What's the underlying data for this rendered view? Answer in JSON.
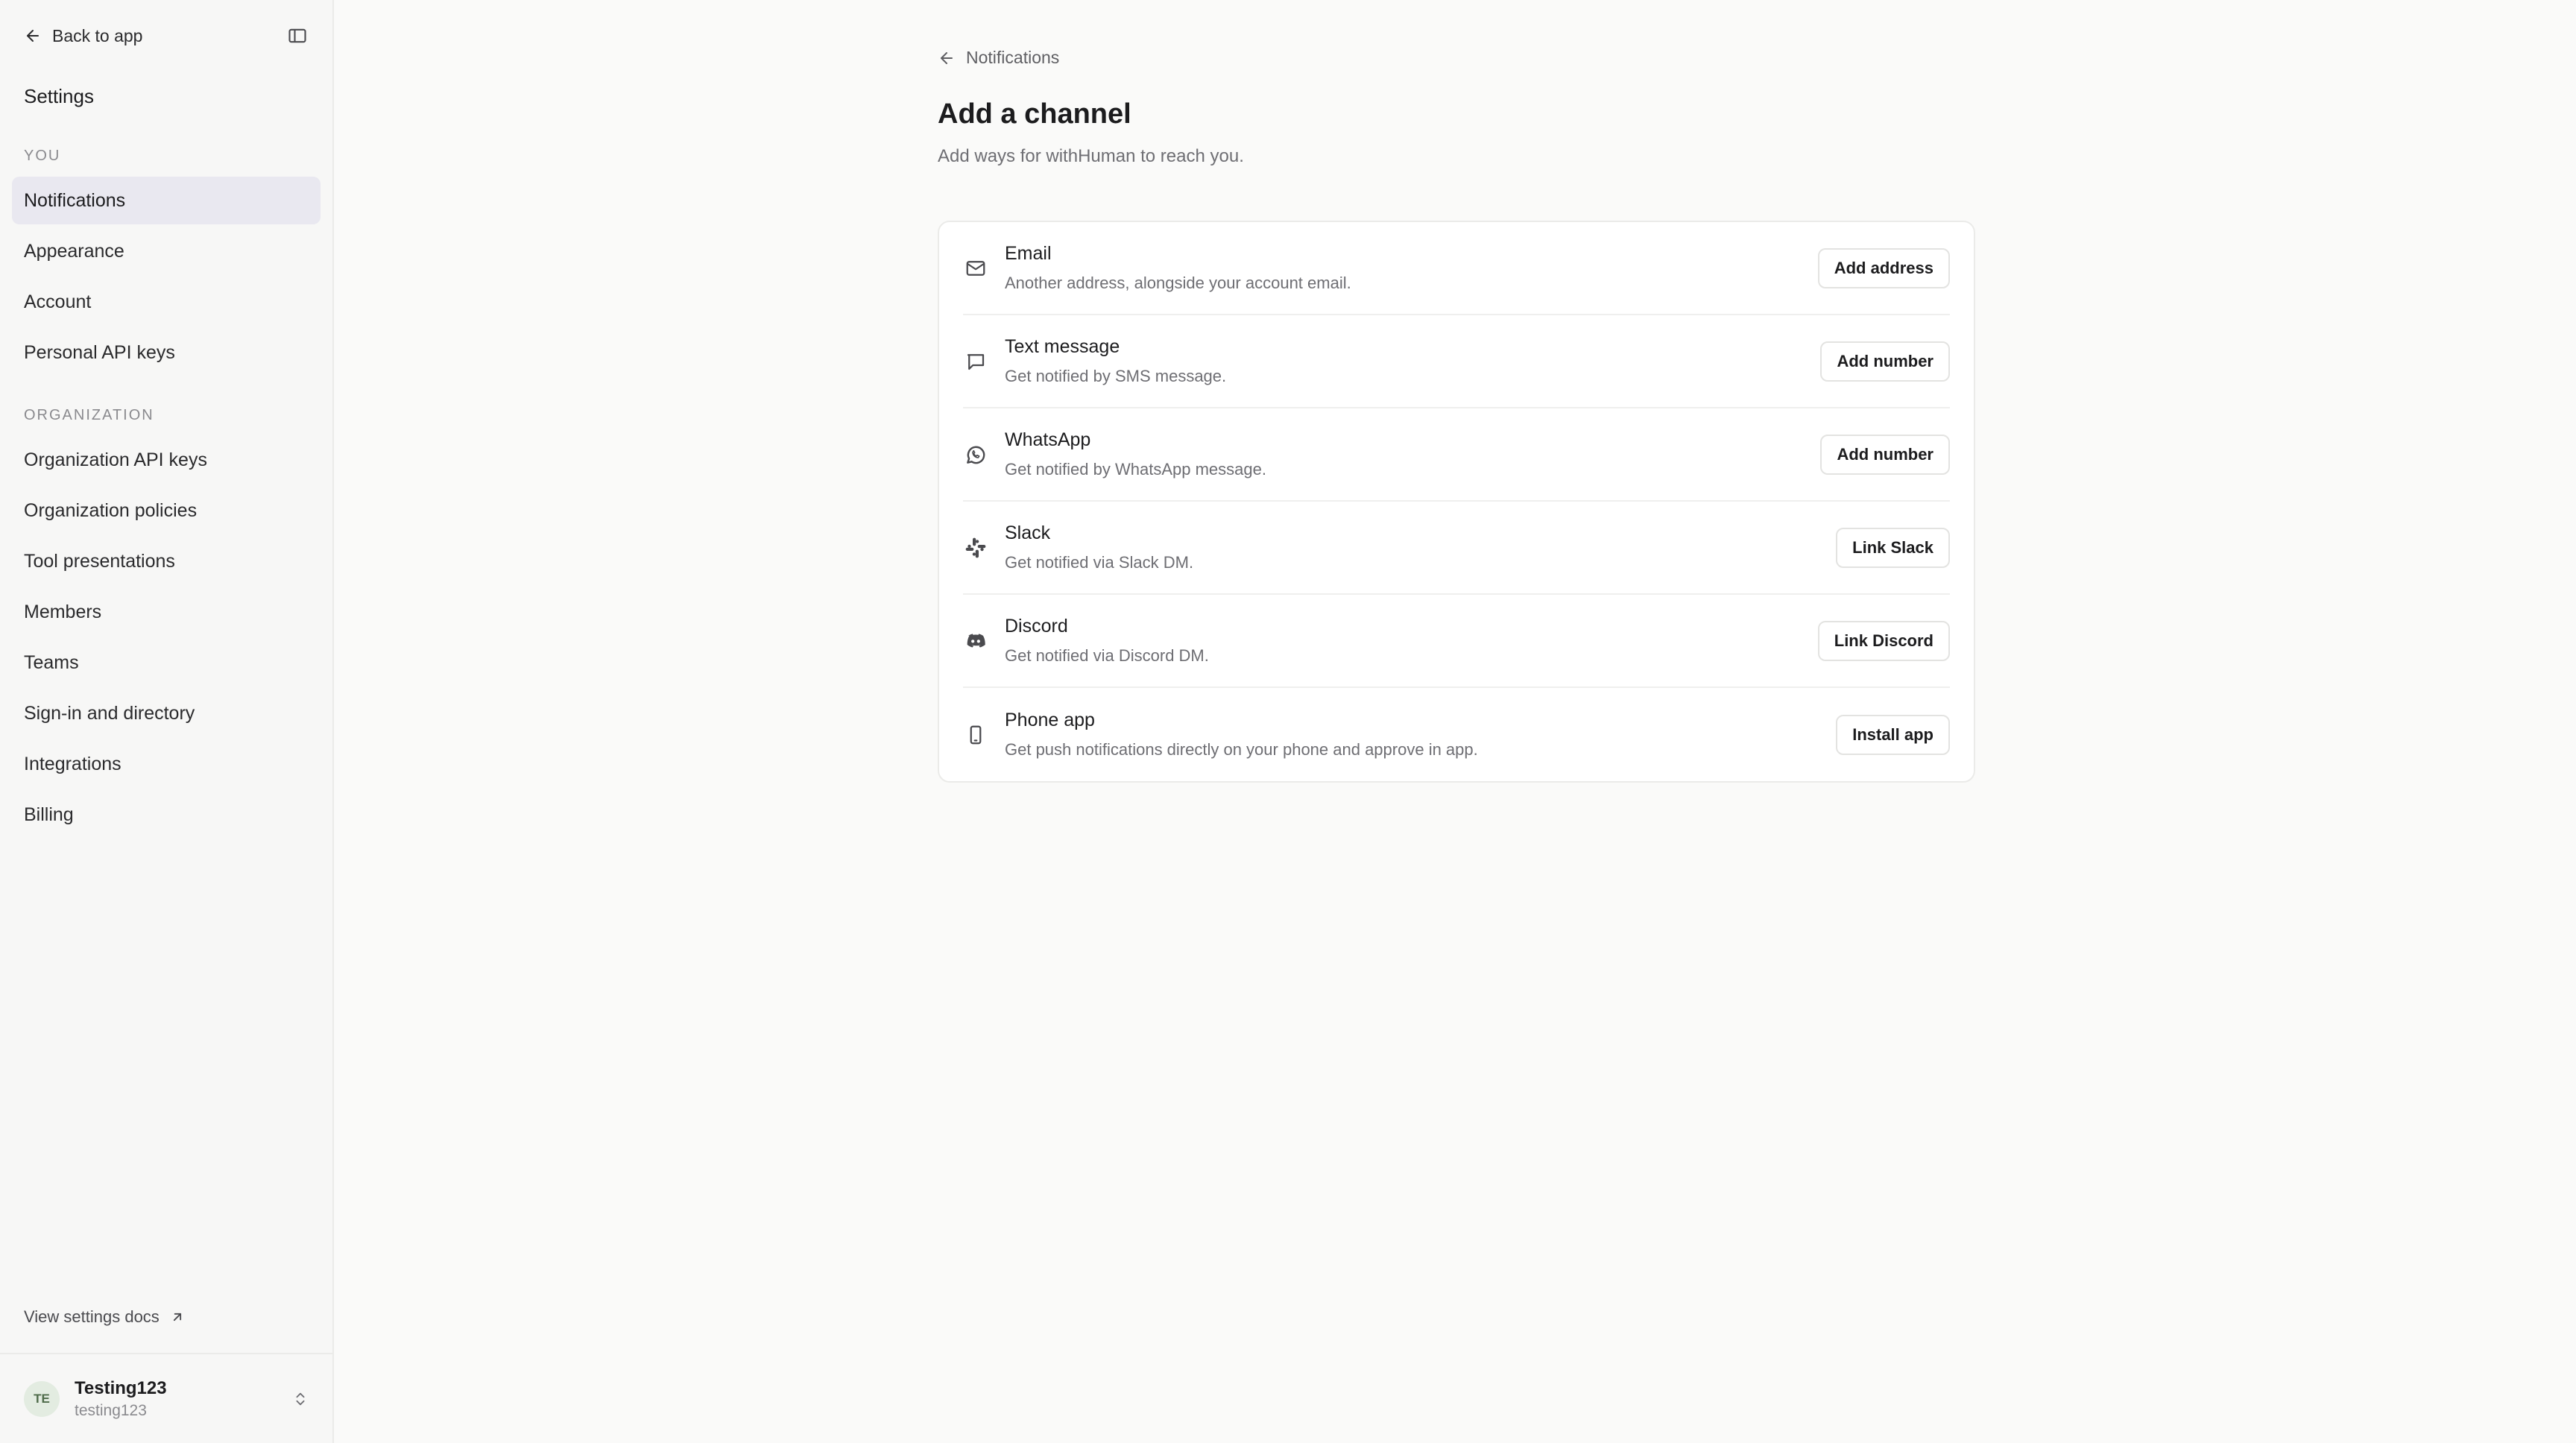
{
  "sidebar": {
    "back_label": "Back to app",
    "title": "Settings",
    "section_you": "YOU",
    "you_items": [
      {
        "label": "Notifications",
        "active": true
      },
      {
        "label": "Appearance"
      },
      {
        "label": "Account"
      },
      {
        "label": "Personal API keys"
      }
    ],
    "section_org": "ORGANIZATION",
    "org_items": [
      {
        "label": "Organization API keys"
      },
      {
        "label": "Organization policies"
      },
      {
        "label": "Tool presentations"
      },
      {
        "label": "Members"
      },
      {
        "label": "Teams"
      },
      {
        "label": "Sign-in and directory"
      },
      {
        "label": "Integrations"
      },
      {
        "label": "Billing"
      }
    ],
    "docs_label": "View settings docs",
    "user": {
      "initials": "TE",
      "name": "Testing123",
      "handle": "testing123"
    }
  },
  "main": {
    "breadcrumb": "Notifications",
    "title": "Add a channel",
    "subtitle": "Add ways for withHuman to reach you.",
    "channels": [
      {
        "icon": "mail-icon",
        "name": "Email",
        "desc": "Another address, alongside your account email.",
        "button": "Add address"
      },
      {
        "icon": "message-icon",
        "name": "Text message",
        "desc": "Get notified by SMS message.",
        "button": "Add number"
      },
      {
        "icon": "whatsapp-icon",
        "name": "WhatsApp",
        "desc": "Get notified by WhatsApp message.",
        "button": "Add number"
      },
      {
        "icon": "slack-icon",
        "name": "Slack",
        "desc": "Get notified via Slack DM.",
        "button": "Link Slack"
      },
      {
        "icon": "discord-icon",
        "name": "Discord",
        "desc": "Get notified via Discord DM.",
        "button": "Link Discord"
      },
      {
        "icon": "phone-icon",
        "name": "Phone app",
        "desc": "Get push notifications directly on your phone and approve in app.",
        "button": "Install app"
      }
    ]
  },
  "colors": {
    "active_nav_bg": "#e9e8f0",
    "avatar_bg": "#e3ece1",
    "avatar_text": "#4f6b4a"
  }
}
